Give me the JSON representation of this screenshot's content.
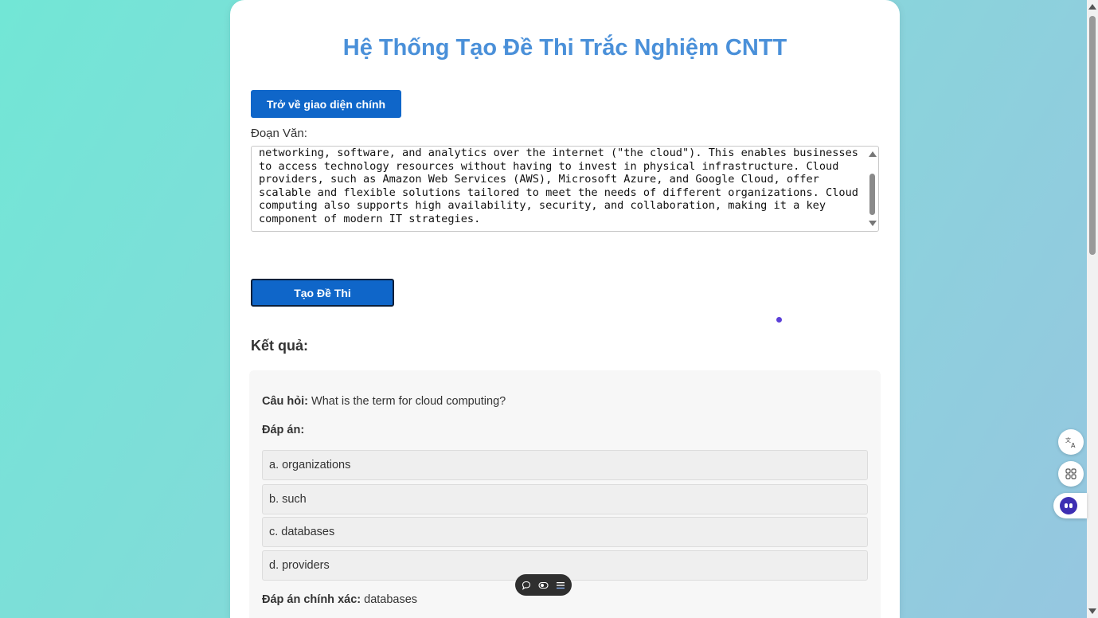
{
  "page": {
    "title": "Hệ Thống Tạo Đề Thi Trắc Nghiệm CNTT",
    "back_button": "Trở về giao diện chính",
    "passage_label": "Đoạn Văn:",
    "passage_text": "networking, software, and analytics over the internet (\"the cloud\"). This enables businesses to access technology resources without having to invest in physical infrastructure. Cloud providers, such as Amazon Web Services (AWS), Microsoft Azure, and Google Cloud, offer scalable and flexible solutions tailored to meet the needs of different organizations. Cloud computing also supports high availability, security, and collaboration, making it a key component of modern IT strategies.",
    "generate_button": "Tạo Đề Thi",
    "result_heading": "Kết quả:"
  },
  "result": {
    "question_label": "Câu hỏi:",
    "question": "What is the term for cloud computing?",
    "answers_label": "Đáp án:",
    "options": [
      "a. organizations",
      "b. such",
      "c. databases",
      "d. providers"
    ],
    "correct_label": "Đáp án chính xác:",
    "correct_answer": "databases"
  },
  "side_widgets": {
    "translate_icon": "translate-icon",
    "apps_icon": "apps-grid-icon",
    "assistant_icon": "assistant-bot-icon"
  },
  "toolbar": {
    "icons": [
      "chat-bubble-icon",
      "toggle-view-icon",
      "list-menu-icon"
    ]
  },
  "colors": {
    "title": "#4a90d9",
    "primary_button": "#0f66c9",
    "background_start": "#72e6d6",
    "background_end": "#96c6e0"
  }
}
